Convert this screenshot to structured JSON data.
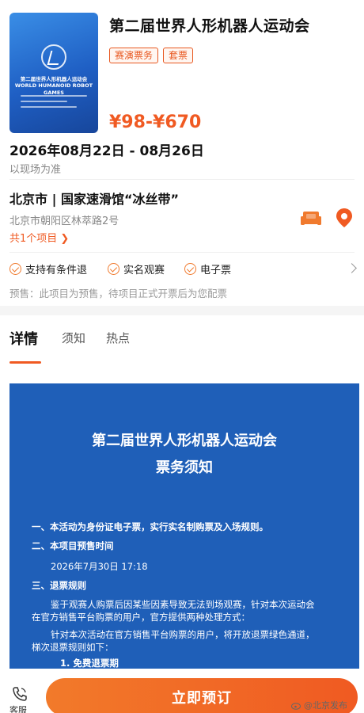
{
  "event": {
    "title": "第二届世界人形机器人运动会",
    "tags": [
      "赛演票务",
      "套票"
    ],
    "price": "¥98-¥670",
    "date": "2026年08月22日 - 08月26日",
    "date_note": "以现场为准"
  },
  "poster": {
    "title": "第二届世界人形机器人运动会",
    "subtitle": "WORLD HUMANOID ROBOT GAMES"
  },
  "venue": {
    "name": "北京市 | 国家速滑馆“冰丝带”",
    "address": "北京市朝阳区林萃路2号",
    "projects": "共1个项目",
    "icons": [
      "sofa-icon",
      "map-pin-icon"
    ]
  },
  "features": [
    "支持有条件退",
    "实名观赛",
    "电子票"
  ],
  "presale": "预售：此项目为预售，待项目正式开票后为您配票",
  "tabs": [
    "详情",
    "须知",
    "热点"
  ],
  "notice": {
    "title1": "第二届世界人形机器人运动会",
    "title2": "票务须知",
    "lines": [
      "一、本活动为身份证电子票，实行实名制购票及入场规则。",
      "二、本项目预售时间",
      "2026年7月30日 17:18",
      "三、退票规则",
      "鉴于观赛人购票后因某些因素导致无法到场观赛，针对本次运动会",
      "在官方销售平台购票的用户，官方提供两种处理方式：",
      "针对本次活动在官方销售平台购票的用户，将开放退票绿色通道，",
      "梯次退票规则如下：",
      "1. 免费退票期"
    ]
  },
  "bottom": {
    "service_label": "客服",
    "buy_label": "立即预订",
    "watermark": "@北京发布"
  },
  "colors": {
    "accent": "#f05a22",
    "notice_bg": "#1f5fb8"
  }
}
